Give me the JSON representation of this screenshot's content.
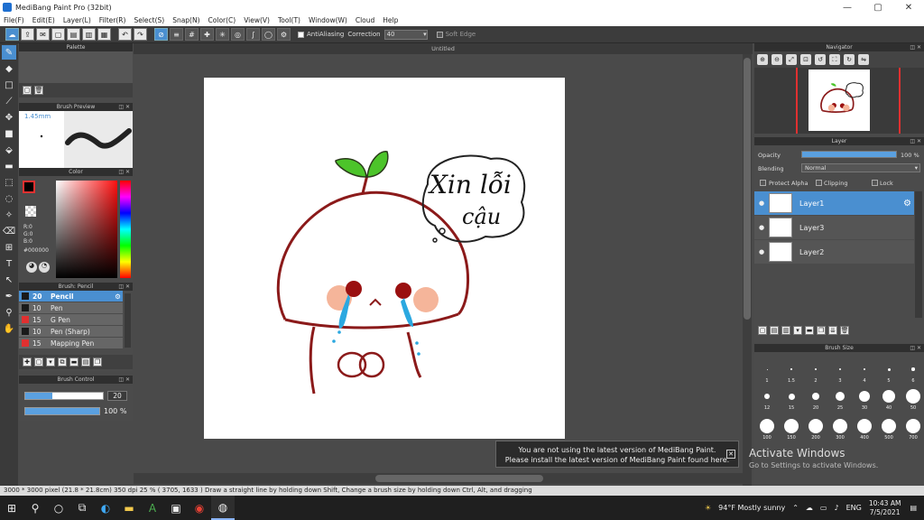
{
  "window": {
    "title": "MediBang Paint Pro (32bit)",
    "minimize": "—",
    "maximize": "▢",
    "close": "✕"
  },
  "menu": [
    "File(F)",
    "Edit(E)",
    "Layer(L)",
    "Filter(R)",
    "Select(S)",
    "Snap(N)",
    "Color(C)",
    "View(V)",
    "Tool(T)",
    "Window(W)",
    "Cloud",
    "Help"
  ],
  "toolbar": {
    "antialiasing_label": "AntiAliasing",
    "correction_label": "Correction",
    "correction_value": "40",
    "soft_edge_label": "Soft Edge"
  },
  "canvas": {
    "tab_title": "Untitled"
  },
  "panels": {
    "palette": "Palette",
    "brush_preview": "Brush Preview",
    "color": "Color",
    "brush": "Brush: Pencil",
    "brush_control": "Brush Control",
    "navigator": "Navigator",
    "layer": "Layer",
    "brush_size": "Brush Size"
  },
  "brush_preview": {
    "size": "1.45mm"
  },
  "color": {
    "r": "R:0",
    "g": "G:0",
    "b": "B:0",
    "hex": "#000000",
    "primary": "#000000",
    "secondary": "#ffffff"
  },
  "brushes": [
    {
      "size": "20",
      "name": "Pencil",
      "color": "#1a1a1a"
    },
    {
      "size": "10",
      "name": "Pen",
      "color": "#1a1a1a"
    },
    {
      "size": "15",
      "name": "G Pen",
      "color": "#e03030"
    },
    {
      "size": "10",
      "name": "Pen (Sharp)",
      "color": "#1a1a1a"
    },
    {
      "size": "15",
      "name": "Mapping Pen",
      "color": "#e03030"
    }
  ],
  "brush_control": {
    "size_value": "20",
    "size_fraction": 0.35,
    "opacity_value": "100 %",
    "opacity_fraction": 1.0
  },
  "layer": {
    "opacity_label": "Opacity",
    "opacity_value": "100 %",
    "opacity_fraction": 1.0,
    "blending_label": "Blending",
    "blending_value": "Normal",
    "protect_alpha_label": "Protect Alpha",
    "clipping_label": "Clipping",
    "lock_label": "Lock",
    "layers": [
      {
        "name": "Layer1",
        "selected": true
      },
      {
        "name": "Layer3",
        "selected": false
      },
      {
        "name": "Layer2",
        "selected": false
      }
    ]
  },
  "brush_sizes": {
    "row1": [
      "1",
      "1.5",
      "2",
      "3",
      "4",
      "5",
      "6"
    ],
    "row2": [
      "12",
      "15",
      "20",
      "25",
      "30",
      "40",
      "50"
    ],
    "row3": [
      "100",
      "150",
      "200",
      "300",
      "400",
      "500",
      "700"
    ]
  },
  "artwork": {
    "speech_text_1": "Xin lỗi",
    "speech_text_2": "cậu",
    "outline_color": "#8b1a1a",
    "leaf_color": "#4cc42a",
    "tear_color": "#2ba8e0",
    "cheek_color": "#f5b59a"
  },
  "notification": {
    "line1": "You are not using the latest version of MediBang Paint.",
    "line2": "Please install the latest version of MediBang Paint found here.",
    "close": "✕"
  },
  "activate_windows": {
    "title": "Activate Windows",
    "subtitle": "Go to Settings to activate Windows."
  },
  "status_bar": "3000 * 3000 pixel  (21.8 * 21.8cm)  350 dpi  25 %  ( 3705, 1633 )  Draw a straight line by holding down Shift, Change a brush size by holding down Ctrl, Alt, and dragging",
  "taskbar": {
    "weather": "94°F  Mostly sunny",
    "language": "ENG",
    "time": "10:43 AM",
    "date": "7/5/2021"
  }
}
